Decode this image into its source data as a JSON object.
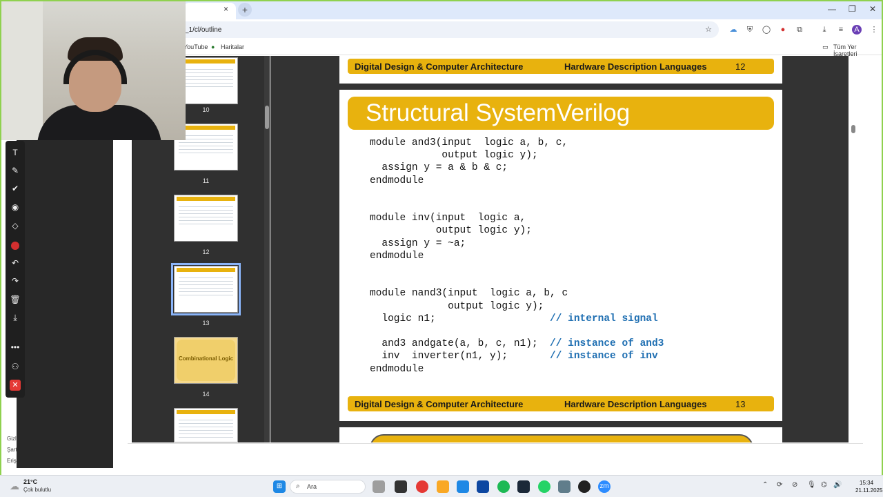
{
  "browser": {
    "tab_close": "×",
    "new_tab": "+",
    "url": "_1/cl/outline",
    "bookmarks": [
      "YouTube",
      "Haritalar"
    ],
    "all_bookmarks": "Tüm Yer İşaretleri",
    "profile_initial": "A"
  },
  "thumbnails": [
    {
      "num": "10"
    },
    {
      "num": "11"
    },
    {
      "num": "12"
    },
    {
      "num": "13"
    },
    {
      "num": "14",
      "text": "Combinational Logic"
    },
    {
      "num": ""
    }
  ],
  "slides": {
    "footer_left": "Digital Design & Computer Architecture",
    "footer_mid": "Hardware Description Languages",
    "prev_page": "12",
    "page": "13",
    "title": "Structural SystemVerilog",
    "code_lines": [
      "module and3(input  logic a, b, c,",
      "            output logic y);",
      "  assign y = a & b & c;",
      "endmodule",
      "",
      "",
      "module inv(input  logic a,",
      "           output logic y);",
      "  assign y = ~a;",
      "endmodule",
      "",
      "",
      "module nand3(input  logic a, b, c",
      "             output logic y);",
      "  logic n1;                   ",
      "",
      "  and3 andgate(a, b, c, n1);  ",
      "  inv  inverter(n1, y);       ",
      "endmodule"
    ],
    "comments": {
      "14": "// internal signal",
      "16": "// instance of and3",
      "17": "// instance of inv"
    }
  },
  "left_strip": [
    "Gizli",
    "Şart",
    "Eriş"
  ],
  "taskbar": {
    "weather_temp": "21°C",
    "weather_desc": "Çok bulutlu",
    "search": "Ara",
    "time": "15:34",
    "date": "21.11.2025"
  }
}
